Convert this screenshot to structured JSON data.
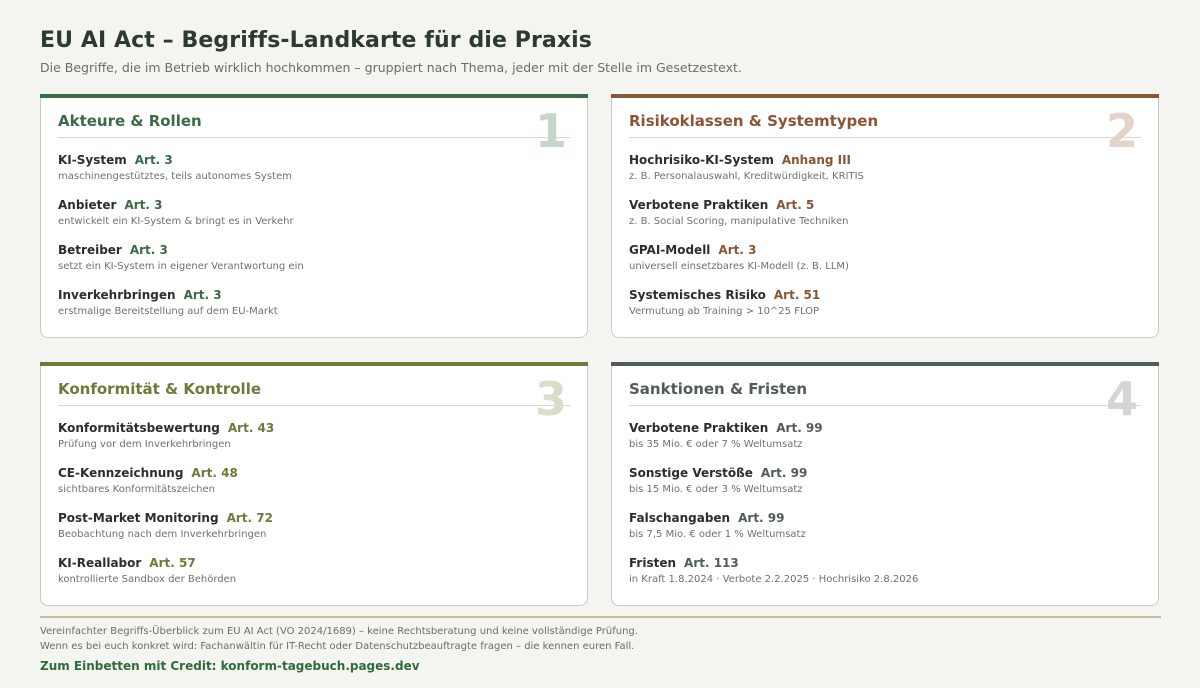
{
  "header": {
    "title": "EU AI Act – Begriffs-Landkarte für die Praxis",
    "subtitle": "Die Begriffe, die im Betrieb wirklich hochkommen – gruppiert nach Thema, jeder mit der Stelle im Gesetzestext."
  },
  "cards": [
    {
      "title": "Akteure & Rollen",
      "number": "1",
      "accent": "#3a6b47",
      "number_color": "#c7d6cb",
      "items": [
        {
          "term": "KI-System",
          "ref": "Art. 3",
          "desc": "maschinengestütztes, teils autonomes System"
        },
        {
          "term": "Anbieter",
          "ref": "Art. 3",
          "desc": "entwickelt ein KI-System & bringt es in Verkehr"
        },
        {
          "term": "Betreiber",
          "ref": "Art. 3",
          "desc": "setzt ein KI-System in eigener Verantwortung ein"
        },
        {
          "term": "Inverkehrbringen",
          "ref": "Art. 3",
          "desc": "erstmalige Bereitstellung auf dem EU-Markt"
        }
      ]
    },
    {
      "title": "Risikoklassen & Systemtypen",
      "number": "2",
      "accent": "#8a5535",
      "number_color": "#e2d4ca",
      "items": [
        {
          "term": "Hochrisiko-KI-System",
          "ref": "Anhang III",
          "desc": "z. B. Personalauswahl, Kreditwürdigkeit, KRITIS"
        },
        {
          "term": "Verbotene Praktiken",
          "ref": "Art. 5",
          "desc": "z. B. Social Scoring, manipulative Techniken"
        },
        {
          "term": "GPAI-Modell",
          "ref": "Art. 3",
          "desc": "universell einsetzbares KI-Modell (z. B. LLM)"
        },
        {
          "term": "Systemisches Risiko",
          "ref": "Art. 51",
          "desc": "Vermutung ab Training > 10^25 FLOP"
        }
      ]
    },
    {
      "title": "Konformität & Kontrolle",
      "number": "3",
      "accent": "#6e7a38",
      "number_color": "#d9ddc9",
      "items": [
        {
          "term": "Konformitätsbewertung",
          "ref": "Art. 43",
          "desc": "Prüfung vor dem Inverkehrbringen"
        },
        {
          "term": "CE-Kennzeichnung",
          "ref": "Art. 48",
          "desc": "sichtbares Konformitätszeichen"
        },
        {
          "term": "Post-Market Monitoring",
          "ref": "Art. 72",
          "desc": "Beobachtung nach dem Inverkehrbringen"
        },
        {
          "term": "KI-Reallabor",
          "ref": "Art. 57",
          "desc": "kontrollierte Sandbox der Behörden"
        }
      ]
    },
    {
      "title": "Sanktionen & Fristen",
      "number": "4",
      "accent": "#515d54",
      "number_color": "#d3d6d2",
      "items": [
        {
          "term": "Verbotene Praktiken",
          "ref": "Art. 99",
          "desc": "bis 35 Mio. € oder 7 % Weltumsatz"
        },
        {
          "term": "Sonstige Verstöße",
          "ref": "Art. 99",
          "desc": "bis 15 Mio. € oder 3 % Weltumsatz"
        },
        {
          "term": "Falschangaben",
          "ref": "Art. 99",
          "desc": "bis 7,5 Mio. € oder 1 % Weltumsatz"
        },
        {
          "term": "Fristen",
          "ref": "Art. 113",
          "desc": "in Kraft 1.8.2024 · Verbote 2.2.2025 · Hochrisiko 2.8.2026"
        }
      ]
    }
  ],
  "footer": {
    "note_1": "Vereinfachter Begriffs-Überblick zum EU AI Act (VO 2024/1689) – keine Rechtsberatung und keine vollständige Prüfung.",
    "note_2": "Wenn es bei euch konkret wird: Fachanwältin für IT-Recht oder Datenschutzbeauftragte fragen – die kennen euren Fall.",
    "credit": "Zum Einbetten mit Credit: konform-tagebuch.pages.dev"
  }
}
